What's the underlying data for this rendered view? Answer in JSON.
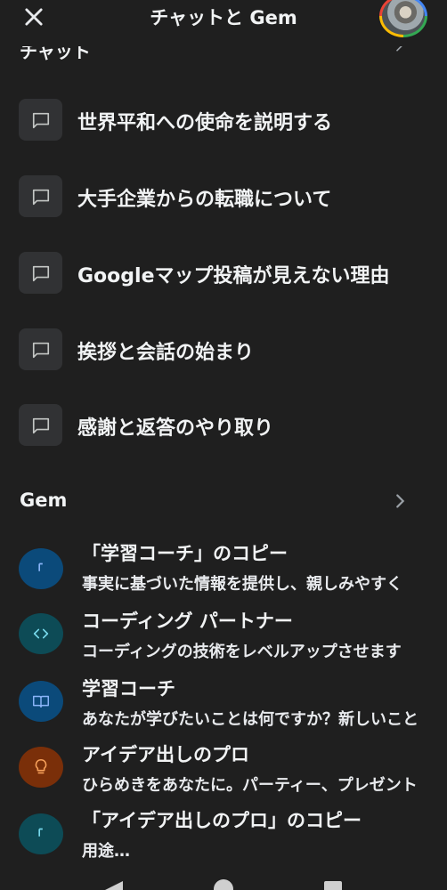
{
  "header": {
    "title": "チャットと Gem",
    "close_icon": "close-icon",
    "avatar_icon": "profile-avatar"
  },
  "chats_section": {
    "label": "チャット"
  },
  "chats": [
    {
      "label": "世界平和への使命を説明する",
      "icon": "chat-bubble-icon"
    },
    {
      "label": "大手企業からの転職について",
      "icon": "chat-bubble-icon"
    },
    {
      "label": "Googleマップ投稿が見えない理由",
      "icon": "chat-bubble-icon"
    },
    {
      "label": "挨拶と会話の始まり",
      "icon": "chat-bubble-icon"
    },
    {
      "label": "感謝と返答のやり取り",
      "icon": "chat-bubble-icon"
    }
  ],
  "gem_section": {
    "label": "Gem"
  },
  "gems": [
    {
      "title": "「学習コーチ」のコピー",
      "desc": "事実に基づいた情報を提供し、親しみやすく",
      "icon": "bracket-icon",
      "bg": "#0b4a7a",
      "fg": "#8ab4f8"
    },
    {
      "title": "コーディング パートナー",
      "desc": "コーディングの技術をレベルアップさせます",
      "icon": "code-icon",
      "bg": "#0d4b56",
      "fg": "#78d9ec"
    },
    {
      "title": "学習コーチ",
      "desc": "あなたが学びたいことは何ですか？新しいこと",
      "icon": "book-icon",
      "bg": "#0b4a7a",
      "fg": "#8ab4f8"
    },
    {
      "title": "アイデア出しのプロ",
      "desc": "ひらめきをあなたに。パーティー、プレゼント",
      "icon": "lightbulb-icon",
      "bg": "#7a2f09",
      "fg": "#f6a05a"
    },
    {
      "title": "「アイデア出しのプロ」のコピー",
      "desc": "用途…",
      "icon": "bracket-icon",
      "bg": "#0d4b56",
      "fg": "#78d9ec"
    }
  ],
  "colors": {
    "background": "#1f1f1f",
    "icon_box": "#313234",
    "text": "#f1f3f4"
  }
}
